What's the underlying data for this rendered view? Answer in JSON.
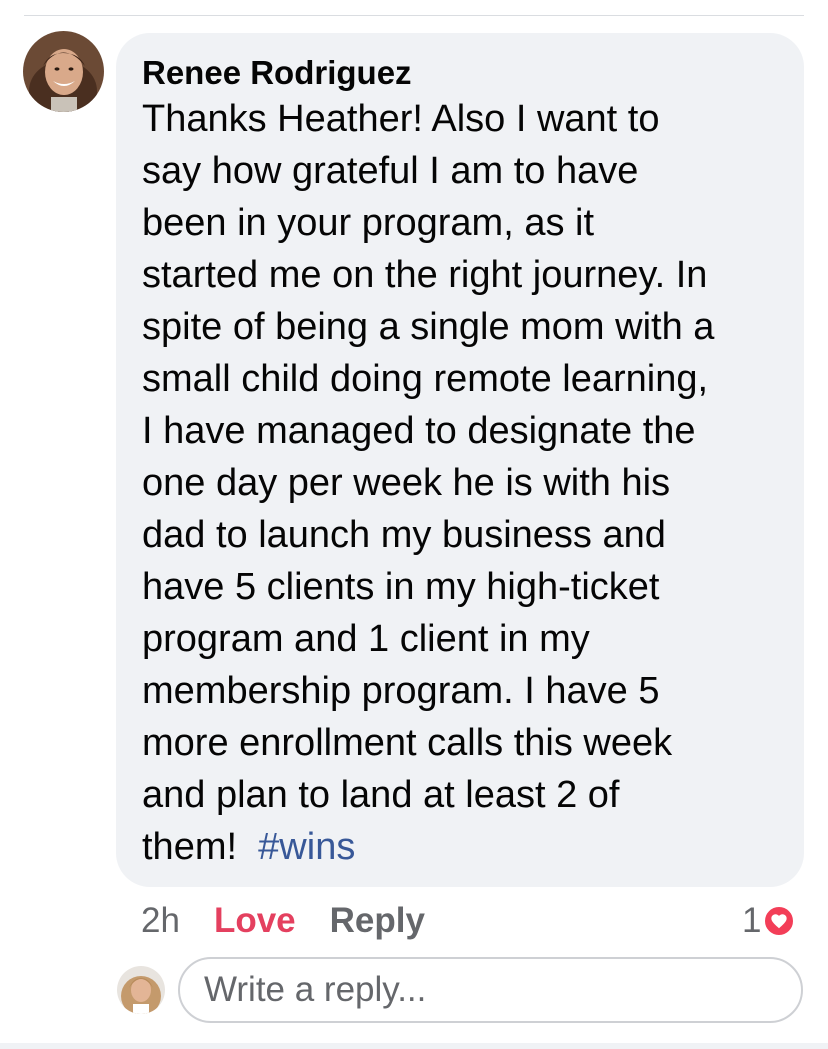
{
  "comment": {
    "author": "Renee Rodriguez",
    "text_lines": [
      "Thanks Heather!  Also I want to",
      "say how grateful I am to have",
      "been in your program, as it",
      "started me on the right journey.  In",
      "spite of being a single mom with a",
      "small child doing remote learning,",
      "I have managed to designate the",
      "one day per week he is with his",
      "dad to launch my business and",
      "have 5 clients in my high-ticket",
      "program and 1 client in my",
      "membership program.  I have 5",
      "more enrollment calls this week",
      "and plan to land at least 2 of",
      "them!"
    ],
    "hashtag": "#wins",
    "time": "2h",
    "love_label": "Love",
    "reply_label": "Reply",
    "reaction_count": "1",
    "reaction_icon": "heart-icon"
  },
  "reply_box": {
    "placeholder": "Write a reply..."
  },
  "colors": {
    "bubble": "#f0f2f5",
    "love": "#e4405f",
    "hashtag": "#385898",
    "muted": "#65676b"
  }
}
